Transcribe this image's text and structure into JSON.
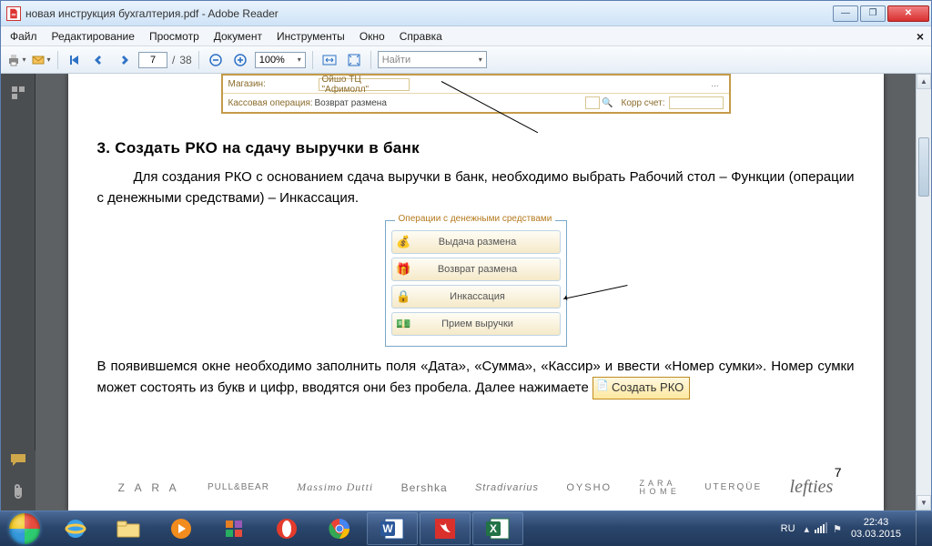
{
  "window": {
    "title": "новая инструкция бухгалтерия.pdf - Adobe Reader"
  },
  "menu": {
    "file": "Файл",
    "edit": "Редактирование",
    "view": "Просмотр",
    "document": "Документ",
    "tools": "Инструменты",
    "window_": "Окно",
    "help": "Справка"
  },
  "toolbar": {
    "page_current": "7",
    "page_sep": "/",
    "page_total": "38",
    "zoom": "100%",
    "find_placeholder": "Найти"
  },
  "doc": {
    "form_shop_label": "Магазин:",
    "form_shop_value": "Ойшо ТЦ \"Афимолл\"",
    "form_op_label": "Кассовая операция:",
    "form_op_value": "Возврат размена",
    "form_korr_label": "Корр счет:",
    "heading": "3. Создать РКО на сдачу выручки в банк",
    "para1": "Для создания РКО с основанием сдача выручки в банк, необходимо выбрать Рабочий стол – Функции (операции с денежными средствами) – Инкассация.",
    "ops_group": "Операции с денежными средствами",
    "ops": {
      "b1": "Выдача размена",
      "b2": "Возврат размена",
      "b3": "Инкассация",
      "b4": "Прием выручки"
    },
    "para2": "В появившемся окне необходимо заполнить поля «Дата», «Сумма», «Кассир» и ввести «Номер сумки». Номер сумки может состоять из букв и цифр, вводятся они без пробела. Далее нажимаете ",
    "create_btn": "Создать РКО",
    "page_number": "7",
    "brands": {
      "b1": "Z A R A",
      "b2": "PULL&BEAR",
      "b3": "Massimo Dutti",
      "b4": "Bershka",
      "b5": "Stradivarius",
      "b6": "OYSHO",
      "b7a": "Z A R A",
      "b7b": "H O M E",
      "b8": "UTERQÜE",
      "b9": "lefties"
    }
  },
  "taskbar": {
    "lang": "RU",
    "time": "22:43",
    "date": "03.03.2015"
  }
}
